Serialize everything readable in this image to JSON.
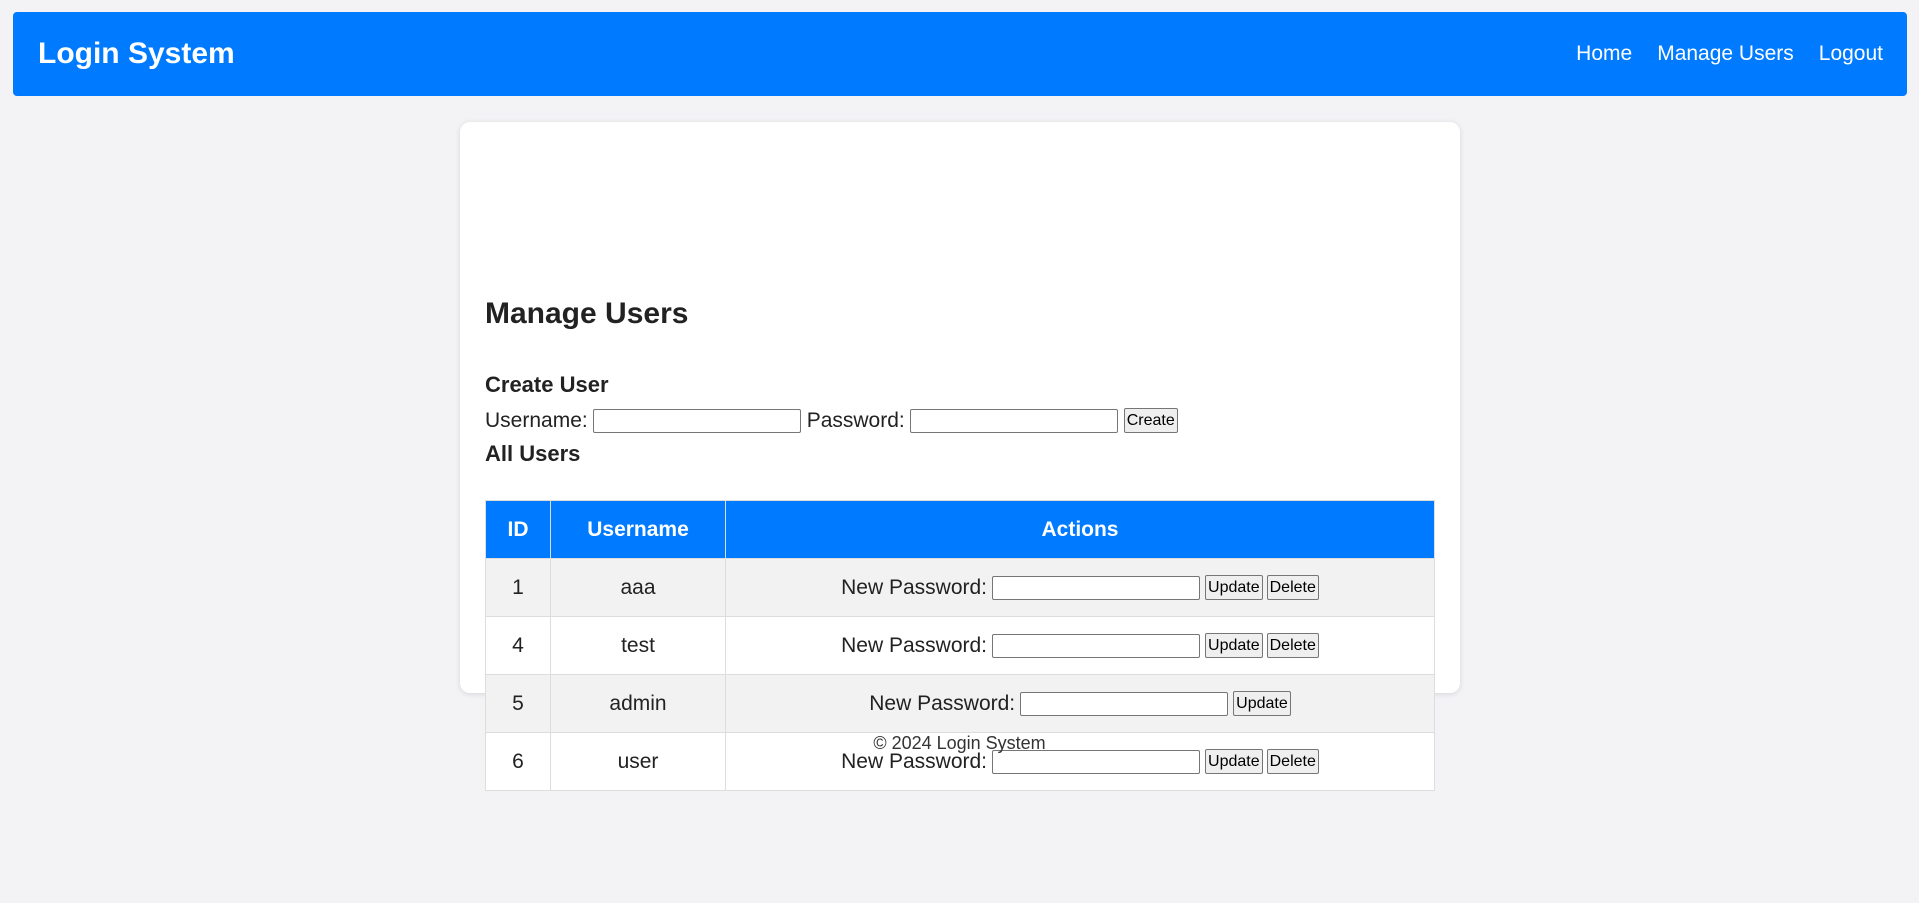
{
  "header": {
    "brand": "Login System",
    "nav": [
      "Home",
      "Manage Users",
      "Logout"
    ]
  },
  "main": {
    "title": "Manage Users",
    "create": {
      "heading": "Create User",
      "username_label": "Username:",
      "password_label": "Password:",
      "username_value": "",
      "password_value": "",
      "create_button": "Create"
    },
    "all_users_heading": "All Users",
    "table": {
      "headers": [
        "ID",
        "Username",
        "Actions"
      ],
      "new_password_label": "New Password:",
      "update_label": "Update",
      "delete_label": "Delete",
      "rows": [
        {
          "id": "1",
          "username": "aaa",
          "can_delete": true
        },
        {
          "id": "4",
          "username": "test",
          "can_delete": true
        },
        {
          "id": "5",
          "username": "admin",
          "can_delete": false
        },
        {
          "id": "6",
          "username": "user",
          "can_delete": true
        }
      ]
    }
  },
  "footer": {
    "text": "© 2024 Login System"
  },
  "colors": {
    "accent": "#007bff",
    "background": "#f3f3f6",
    "row_alt": "#f2f2f2"
  }
}
